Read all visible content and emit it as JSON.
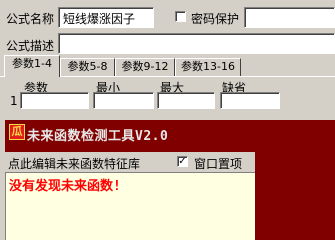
{
  "formula": {
    "name_label": "公式名称",
    "name_value": "短线爆涨因子",
    "password_label": "密码保护",
    "password_checked": false,
    "desc_label": "公式描述",
    "desc_value": ""
  },
  "tabs": [
    {
      "label": "参数1-4",
      "active": true
    },
    {
      "label": "参数5-8",
      "active": false
    },
    {
      "label": "参数9-12",
      "active": false
    },
    {
      "label": "参数13-16",
      "active": false
    }
  ],
  "params": {
    "headers": [
      "参数",
      "最小",
      "最大",
      "缺省"
    ],
    "rows": [
      {
        "index": "1",
        "name": "",
        "min": "",
        "max": "",
        "default": ""
      }
    ]
  },
  "dialog": {
    "title": "未来函数检测工具V2.0",
    "icon_glyph": "瓜",
    "edit_link": "点此编辑未来函数特征库",
    "topmost_label": "窗口置项",
    "topmost_checked": true,
    "result": "没有发现未来函数!"
  },
  "colors": {
    "dialog_bg": "#800000",
    "result_bg": "#ffffe1",
    "result_text": "#ff0000",
    "window_bg": "#d4d0c8"
  }
}
